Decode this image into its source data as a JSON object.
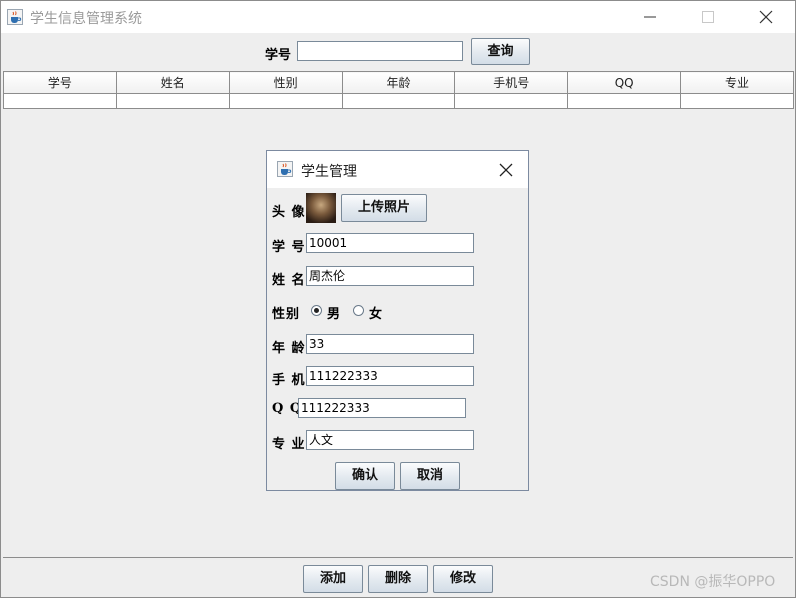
{
  "window": {
    "title": "学生信息管理系统"
  },
  "search": {
    "label": "学号",
    "value": "",
    "button": "查询"
  },
  "table": {
    "columns": [
      "学号",
      "姓名",
      "性别",
      "年龄",
      "手机号",
      "QQ",
      "专业"
    ]
  },
  "dialog": {
    "title": "学生管理",
    "avatar_label": "头 像",
    "upload_button": "上传照片",
    "fields": {
      "id": {
        "label": "学 号",
        "value": "10001"
      },
      "name": {
        "label": "姓 名",
        "value": "周杰伦"
      },
      "gender": {
        "label": "性别",
        "options": [
          "男",
          "女"
        ],
        "selected": "男"
      },
      "age": {
        "label": "年 龄",
        "value": "33"
      },
      "phone": {
        "label": "手 机",
        "value": "111222333"
      },
      "qq": {
        "label": "Q Q",
        "value": "111222333"
      },
      "major": {
        "label": "专 业",
        "value": "人文"
      }
    },
    "confirm_button": "确认",
    "cancel_button": "取消"
  },
  "footer": {
    "add_button": "添加",
    "delete_button": "删除",
    "edit_button": "修改"
  },
  "watermark": "CSDN @振华OPPO",
  "icons": {
    "app": "java-cup-icon",
    "minimize": "minimize-icon",
    "maximize": "maximize-icon",
    "close": "close-icon"
  }
}
